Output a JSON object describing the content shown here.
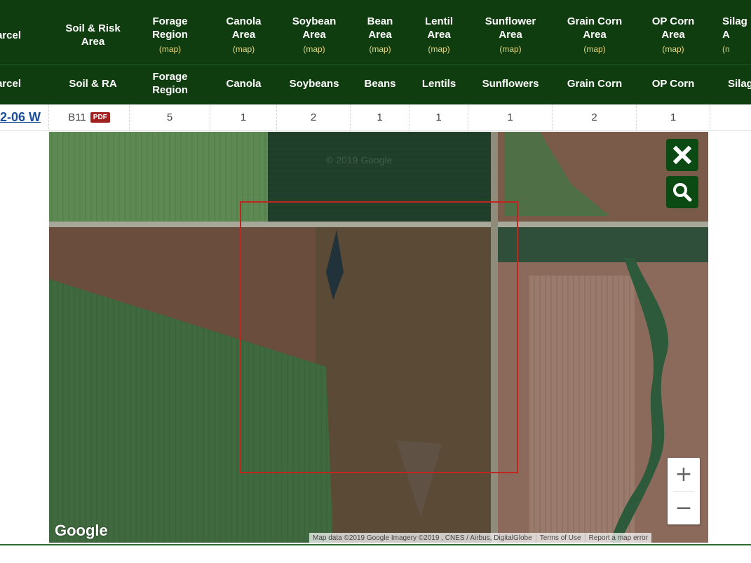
{
  "header": {
    "row1": [
      {
        "id": "parcel",
        "label": "arcel",
        "map": ""
      },
      {
        "id": "soil",
        "label": "Soil & Risk Area",
        "map": ""
      },
      {
        "id": "forage",
        "label": "Forage Region",
        "map": "(map)"
      },
      {
        "id": "canola",
        "label": "Canola Area",
        "map": "(map)"
      },
      {
        "id": "soybean",
        "label": "Soybean Area",
        "map": "(map)"
      },
      {
        "id": "bean",
        "label": "Bean Area",
        "map": "(map)"
      },
      {
        "id": "lentil",
        "label": "Lentil Area",
        "map": "(map)"
      },
      {
        "id": "sunflower",
        "label": "Sunflower Area",
        "map": "(map)"
      },
      {
        "id": "graincorn",
        "label": "Grain Corn Area",
        "map": "(map)"
      },
      {
        "id": "opcorn",
        "label": "OP Corn Area",
        "map": "(map)"
      },
      {
        "id": "silage",
        "label": "Silag A",
        "map": "(n"
      }
    ],
    "row2": [
      "arcel",
      "Soil & RA",
      "Forage Region",
      "Canola",
      "Soybeans",
      "Beans",
      "Lentils",
      "Sunflowers",
      "Grain Corn",
      "OP Corn",
      "Silag"
    ]
  },
  "row": {
    "parcel": "2-06  W",
    "soil": "B11",
    "pdf": "PDF",
    "values": [
      "5",
      "1",
      "2",
      "1",
      "1",
      "1",
      "2",
      "1",
      ""
    ]
  },
  "map": {
    "close_icon": "close-icon",
    "search_icon": "search-icon",
    "zoom_in": "+",
    "zoom_out": "−",
    "google": "Google",
    "attribution": "Map data ©2019 Google Imagery ©2019 , CNES / Airbus, DigitalGlobe",
    "terms": "Terms of Use",
    "report": "Report a map error",
    "watermark": "© 2019 Google"
  },
  "colors": {
    "header_bg": "#0f3d0f",
    "map_link": "#e8d57a",
    "pdf_badge": "#a12121",
    "map_button": "#0b4a12",
    "selection_box": "#c0261f"
  }
}
